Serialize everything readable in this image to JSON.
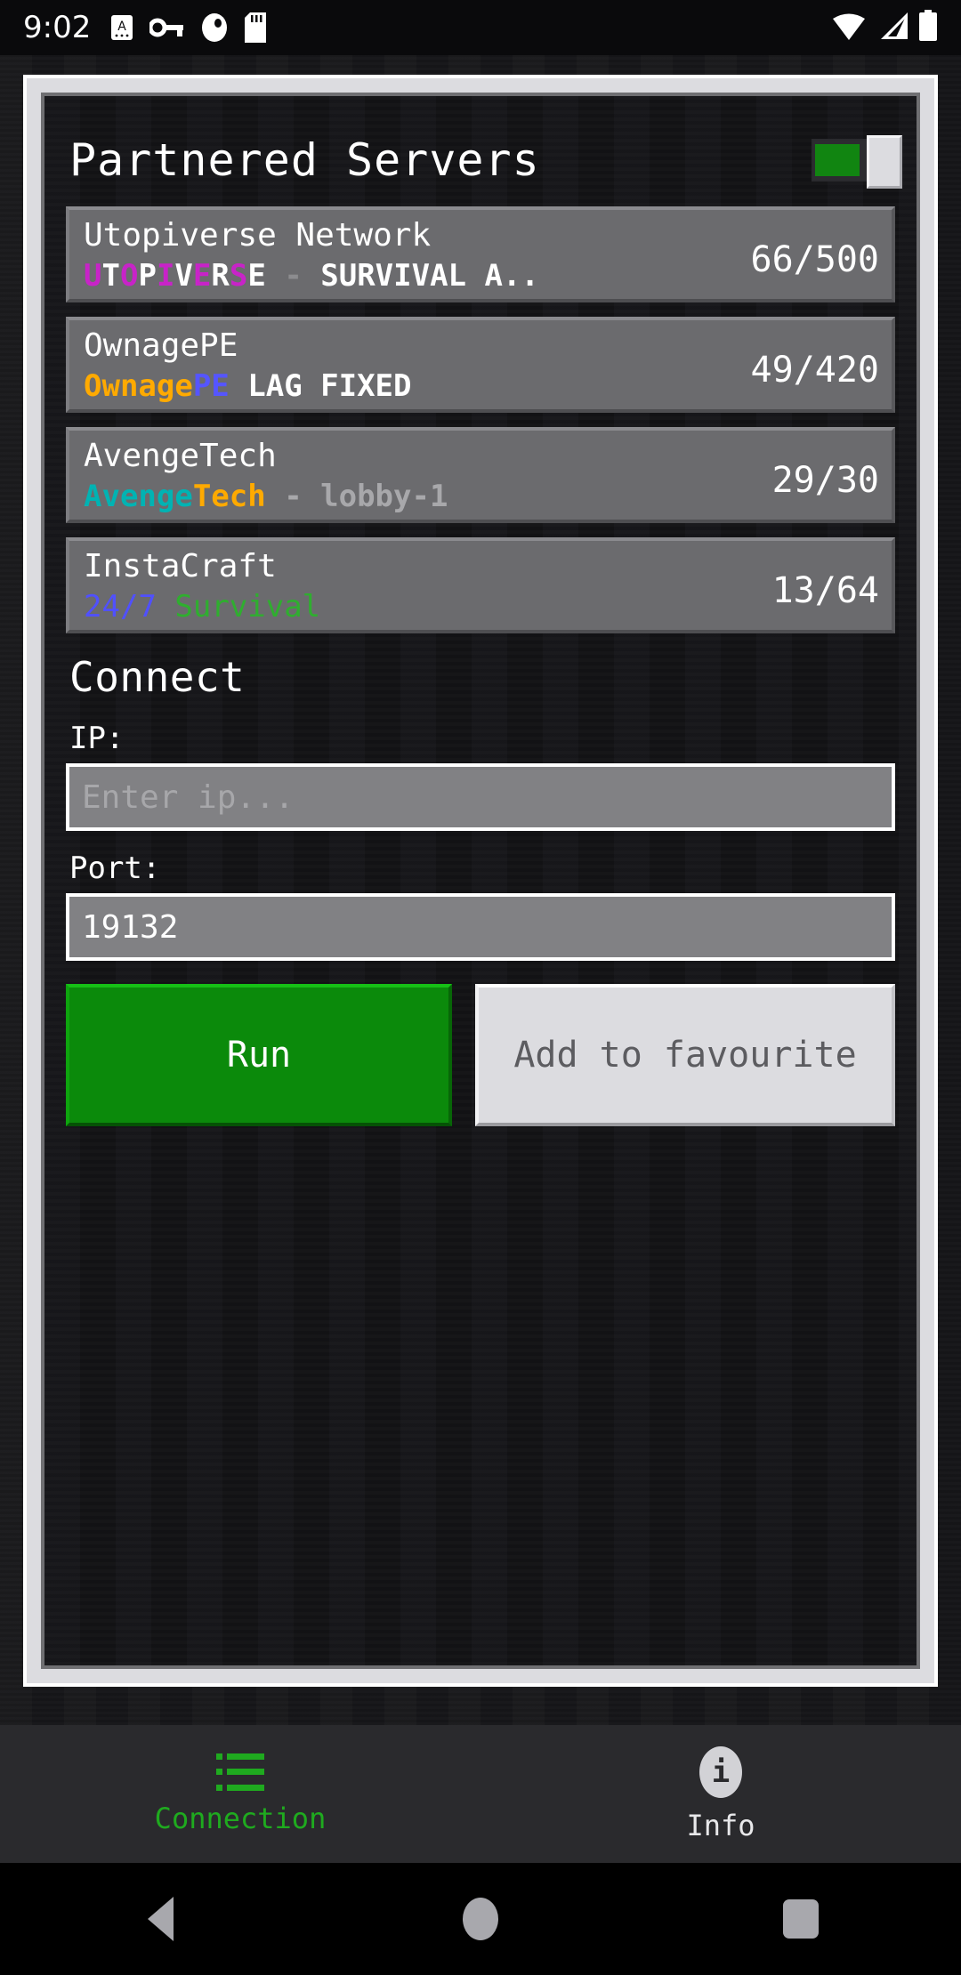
{
  "status_bar": {
    "time": "9:02",
    "icons": [
      "alphabet-mode-icon",
      "vpn-key-icon",
      "app-badge-icon",
      "sd-card-icon"
    ],
    "right_icons": [
      "wifi-icon",
      "cellular-signal-icon",
      "battery-icon"
    ]
  },
  "header": {
    "title": "Partnered Servers",
    "toggle": {
      "name": "partnered-servers-toggle",
      "state": "on",
      "on_color": "#118511"
    }
  },
  "servers": [
    {
      "name": "Utopiverse Network",
      "players": "66/500",
      "motd_segments": [
        {
          "text": "U",
          "color": "#c823c8"
        },
        {
          "text": "T",
          "color": "#ffffff"
        },
        {
          "text": "O",
          "color": "#c823c8"
        },
        {
          "text": "P",
          "color": "#ffffff"
        },
        {
          "text": "I",
          "color": "#c823c8"
        },
        {
          "text": "V",
          "color": "#ffffff"
        },
        {
          "text": "E",
          "color": "#c823c8"
        },
        {
          "text": "R",
          "color": "#ffffff"
        },
        {
          "text": "S",
          "color": "#c823c8"
        },
        {
          "text": "E",
          "color": "#ffffff"
        },
        {
          "text": " - ",
          "color": "#8c8c8f"
        },
        {
          "text": "SURVIVAL A..",
          "color": "#ffffff"
        }
      ]
    },
    {
      "name": "OwnagePE",
      "players": "49/420",
      "motd_segments": [
        {
          "text": "Ownage",
          "color": "#ffaa00"
        },
        {
          "text": "PE",
          "color": "#5555ff"
        },
        {
          "text": " LAG FIXED",
          "color": "#ffffff"
        }
      ]
    },
    {
      "name": "AvengeTech",
      "players": "29/30",
      "motd_segments": [
        {
          "text": "Avenge",
          "color": "#00b3b3"
        },
        {
          "text": "Tech",
          "color": "#ffaa00"
        },
        {
          "text": " - ",
          "color": "#a8a8ab"
        },
        {
          "text": "lobby-1",
          "color": "#a8a8ab"
        }
      ]
    },
    {
      "name": "InstaCraft",
      "players": "13/64",
      "thin_motd": true,
      "motd_segments": [
        {
          "text": "24/7",
          "color": "#5050ff"
        },
        {
          "text": " ",
          "color": "#ffffff"
        },
        {
          "text": "Survival",
          "color": "#2fae2f"
        }
      ]
    }
  ],
  "connect": {
    "heading": "Connect",
    "ip_label": "IP:",
    "ip_value": "",
    "ip_placeholder": "Enter ip...",
    "port_label": "Port:",
    "port_value": "19132",
    "port_placeholder": "",
    "run_label": "Run",
    "favourite_label": "Add to favourite",
    "run_color": "#0b8a0b"
  },
  "bottom_nav": {
    "items": [
      {
        "label": "Connection",
        "icon": "list-icon",
        "active": true,
        "active_color": "#1faa1f"
      },
      {
        "label": "Info",
        "icon": "info-circle-icon",
        "active": false
      }
    ]
  },
  "android_nav": {
    "back": "back-triangle-icon",
    "home": "home-circle-icon",
    "recents": "recents-square-icon"
  }
}
